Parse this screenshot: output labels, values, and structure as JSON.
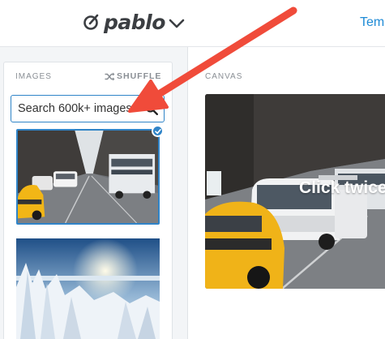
{
  "header": {
    "brand_name": "pablo",
    "brand_icon": "pablo-logo-icon",
    "brand_dropdown_icon": "chevron-down-icon",
    "nav_link": "Tem"
  },
  "sidebar": {
    "section_label": "IMAGES",
    "shuffle_label": "SHUFFLE",
    "shuffle_icon": "shuffle-icon",
    "search": {
      "placeholder": "Search 600k+ images",
      "value": "",
      "icon": "search-icon"
    },
    "images": [
      {
        "subject": "city street with yellow taxi and bus",
        "selected": true
      },
      {
        "subject": "snowy mountain landscape",
        "selected": false
      }
    ]
  },
  "canvas": {
    "section_label": "CANVAS",
    "overlay_text": "Click twice t"
  },
  "annotation": {
    "type": "red-arrow",
    "color": "#f04b3a"
  },
  "colors": {
    "accent": "#2f84c8",
    "nav_link": "#1f8bd6",
    "arrow": "#f04b3a"
  }
}
